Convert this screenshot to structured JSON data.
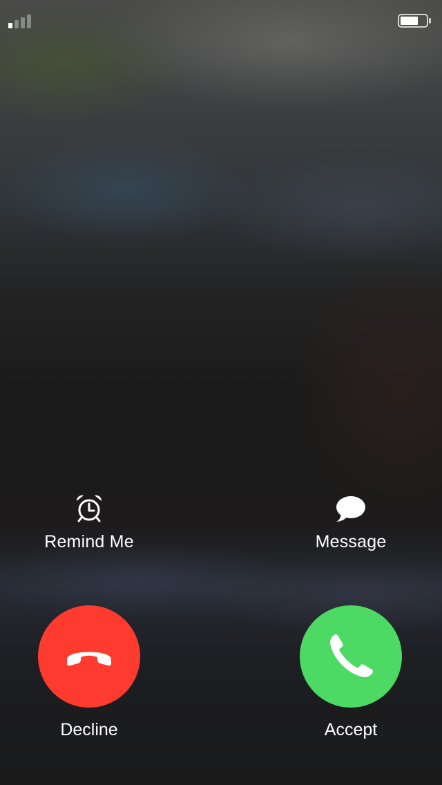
{
  "status_bar": {
    "signal_bars_filled": 1,
    "signal_bars_total": 4,
    "battery_level_percent": 70,
    "icons": [
      "signal-strength-icon",
      "battery-icon"
    ]
  },
  "actions": {
    "remind": {
      "label": "Remind Me",
      "icon": "alarm-clock-icon"
    },
    "message": {
      "label": "Message",
      "icon": "speech-bubble-icon"
    }
  },
  "call": {
    "decline": {
      "label": "Decline",
      "icon": "phone-hangup-icon",
      "color": "#ff3b30"
    },
    "accept": {
      "label": "Accept",
      "icon": "phone-icon",
      "color": "#4cd964"
    }
  },
  "colors": {
    "text": "#ffffff",
    "decline": "#ff3b30",
    "accept": "#4cd964"
  }
}
